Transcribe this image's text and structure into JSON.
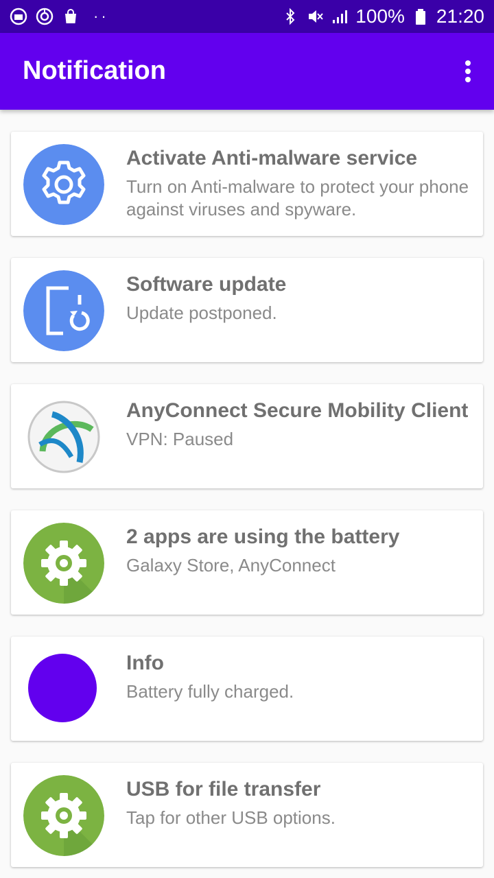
{
  "status_bar": {
    "battery_percent": "100%",
    "time": "21:20",
    "left_icons": [
      "gallery-icon",
      "sync-icon",
      "shopping-bag-icon",
      "more-dots-icon"
    ],
    "right_icons": [
      "bluetooth-icon",
      "mute-icon",
      "signal-icon",
      "battery-icon"
    ]
  },
  "app_bar": {
    "title": "Notification",
    "menu_icon": "overflow-menu-icon"
  },
  "colors": {
    "status_bar": "#3a00a8",
    "app_bar": "#6200ee",
    "blue_icon": "#5b8def",
    "green_icon": "#7cb342",
    "purple_icon": "#6200ee"
  },
  "notifications": [
    {
      "title": "Activate Anti-malware service",
      "description": "Turn on Anti-malware to protect your phone against viruses and spyware.",
      "icon": "settings-gear-icon"
    },
    {
      "title": "Software update",
      "description": "Update postponed.",
      "icon": "software-update-icon"
    },
    {
      "title": "AnyConnect Secure Mobility Client",
      "description": "VPN: Paused",
      "icon": "anyconnect-logo-icon"
    },
    {
      "title": "2 apps are using the battery",
      "description": "Galaxy Store, AnyConnect",
      "icon": "settings-gear-icon"
    },
    {
      "title": "Info",
      "description": "Battery fully charged.",
      "icon": "purple-circle-icon"
    },
    {
      "title": "USB for file transfer",
      "description": "Tap for other USB options.",
      "icon": "settings-gear-icon"
    }
  ]
}
